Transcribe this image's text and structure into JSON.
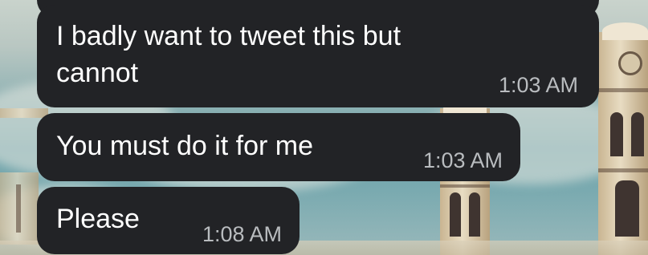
{
  "chat": {
    "messages": [
      {
        "text": "I badly want to tweet this but\ncannot",
        "time": "1:03 AM"
      },
      {
        "text": "You must do it for me",
        "time": "1:03 AM"
      },
      {
        "text": "Please",
        "time": "1:08 AM"
      }
    ]
  },
  "colors": {
    "bubble": "#222326",
    "text": "#ffffff",
    "timestamp": "#b9bcbf",
    "wallpaper_sky": "#8fb3b5"
  }
}
